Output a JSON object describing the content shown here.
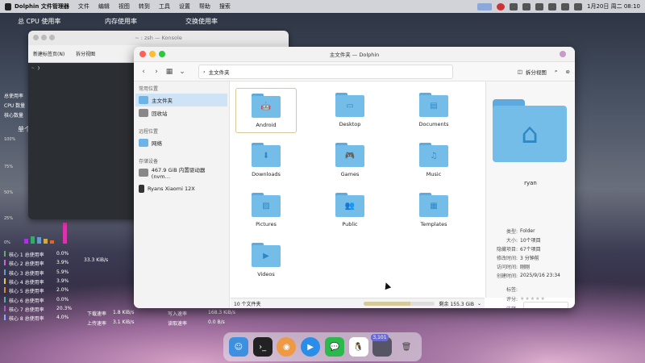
{
  "menubar": {
    "app": "Dolphin 文件管理器",
    "items": [
      "文件",
      "编辑",
      "视图",
      "转到",
      "工具",
      "设置",
      "帮助",
      "搜索"
    ],
    "clock": "1月20日 周二 08:10"
  },
  "widget": {
    "cpu_title": "总 CPU 使用率",
    "mem_title": "内存使用率",
    "swap_title": "交换使用率",
    "left_labels": [
      "总使用率",
      "CPU 数量",
      "核心数量"
    ],
    "single": "单个",
    "pct_labels": [
      "100%",
      "75%",
      "50%",
      "25%",
      "0%"
    ],
    "cores": [
      {
        "name": "核心 1 总使用率",
        "val": "0.0%"
      },
      {
        "name": "核心 2 总使用率",
        "val": "3.9%"
      },
      {
        "name": "核心 3 总使用率",
        "val": "5.9%"
      },
      {
        "name": "核心 4 总使用率",
        "val": "3.9%"
      },
      {
        "name": "核心 5 总使用率",
        "val": "2.0%"
      },
      {
        "name": "核心 6 总使用率",
        "val": "0.0%"
      },
      {
        "name": "核心 7 总使用率",
        "val": "20.3%"
      },
      {
        "name": "核心 8 总使用率",
        "val": "4.0%"
      }
    ],
    "net": {
      "rate1": "33.3 KiB/s",
      "down_label": "下载速率",
      "down": "1.8 KiB/s",
      "up_label": "上传速率",
      "up": "3.1 KiB/s",
      "write_label": "写入速率",
      "write": "168.3 KiB/s",
      "read_label": "读取速率",
      "read": "0.0 B/s"
    }
  },
  "konsole": {
    "title": "~ : zsh — Konsole",
    "new_tab": "新建标签页(N)",
    "split": "拆分视图",
    "prompt": "~ ❯"
  },
  "dolphin": {
    "title": "主文件夹 — Dolphin",
    "breadcrumb": "主文件夹",
    "split_label": "拆分视图",
    "sidebar": {
      "places_head": "常用位置",
      "home": "主文件夹",
      "trash": "回收站",
      "remote_head": "远程位置",
      "network": "网络",
      "devices_head": "存储设备",
      "disk": "467.9 GiB 内置驱动器 (nvm…",
      "phone": "Ryans Xiaomi 12X"
    },
    "files": [
      {
        "name": "Android",
        "glyph": "🤖"
      },
      {
        "name": "Desktop",
        "glyph": "▭"
      },
      {
        "name": "Documents",
        "glyph": "▤"
      },
      {
        "name": "Downloads",
        "glyph": "⬇"
      },
      {
        "name": "Games",
        "glyph": "🎮"
      },
      {
        "name": "Music",
        "glyph": "♫"
      },
      {
        "name": "Pictures",
        "glyph": "▨"
      },
      {
        "name": "Public",
        "glyph": "👥"
      },
      {
        "name": "Templates",
        "glyph": "▦"
      },
      {
        "name": "Videos",
        "glyph": "▶"
      }
    ],
    "status": {
      "count": "10 个文件夹",
      "free": "剩余 155.3 GiB",
      "used_fraction": 0.67
    },
    "info": {
      "name": "ryan",
      "rows": [
        {
          "k": "类型:",
          "v": "Folder"
        },
        {
          "k": "大小:",
          "v": "10个项目"
        },
        {
          "k": "隐藏项目:",
          "v": "67个项目"
        },
        {
          "k": "修改时间:",
          "v": "3 分钟前"
        },
        {
          "k": "访问时间:",
          "v": "刚刚"
        },
        {
          "k": "创建时间:",
          "v": "2025/9/16 23:34"
        },
        {
          "k": "标签:",
          "v": ""
        },
        {
          "k": "评分:",
          "v": "★★★★★"
        },
        {
          "k": "注释:",
          "v": ""
        }
      ]
    }
  },
  "dock": {
    "badge": "3,101"
  },
  "colors": {
    "accent": "#74bde9",
    "selection": "#cfe3f6"
  }
}
